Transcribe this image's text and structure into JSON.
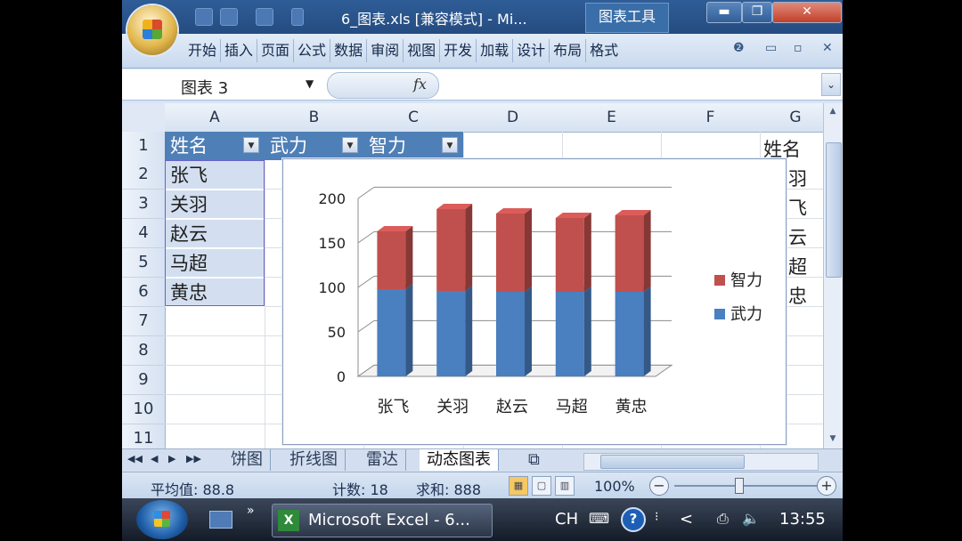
{
  "window": {
    "title": "6_图表.xls  [兼容模式] - Mi...",
    "context_tab": "图表工具",
    "buttons": {
      "minimize": "▬",
      "restore": "❐",
      "close": "✕"
    }
  },
  "ribbon": {
    "tabs": [
      "开始",
      "插入",
      "页面",
      "公式",
      "数据",
      "审阅",
      "视图",
      "开发",
      "加载",
      "设计",
      "布局",
      "格式"
    ],
    "help": "❷",
    "min": "▭",
    "restore": "▫",
    "close": "✕"
  },
  "formula_bar": {
    "name_box": "图表 3",
    "name_arrow": "▼",
    "fx": "fx",
    "expand": "⌄"
  },
  "columns": [
    "A",
    "B",
    "C",
    "D",
    "E",
    "F",
    "G"
  ],
  "rows": [
    "1",
    "2",
    "3",
    "4",
    "5",
    "6",
    "7",
    "8",
    "9",
    "10",
    "11"
  ],
  "table": {
    "headers": [
      "姓名",
      "武力",
      "智力"
    ],
    "names": [
      "张飞",
      "关羽",
      "赵云",
      "马超",
      "黄忠"
    ],
    "col_g": [
      "姓名",
      "羽",
      "飞",
      "云",
      "超",
      "忠"
    ],
    "filter_arrow": "▼"
  },
  "chart_data": {
    "type": "bar",
    "stacked": true,
    "style": "3d-column",
    "categories": [
      "张飞",
      "关羽",
      "赵云",
      "马超",
      "黄忠"
    ],
    "series": [
      {
        "name": "武力",
        "color": "#4a7fc0",
        "values": [
          98,
          96,
          95,
          95,
          95
        ]
      },
      {
        "name": "智力",
        "color": "#c0504d",
        "values": [
          65,
          92,
          88,
          83,
          86
        ]
      }
    ],
    "ylim": [
      0,
      200
    ],
    "yticks": [
      "0",
      "50",
      "100",
      "150",
      "200"
    ],
    "grid": true,
    "legend": "right"
  },
  "sheet_tabs": {
    "nav": [
      "◀◀",
      "◀",
      "▶",
      "▶▶"
    ],
    "tabs": [
      "饼图",
      "折线图",
      "雷达",
      "动态图表"
    ],
    "active": "动态图表"
  },
  "status": {
    "average": "平均值: 88.8",
    "count": "计数: 18",
    "sum": "求和: 888",
    "zoom": "100%",
    "zoom_minus": "−",
    "zoom_plus": "+"
  },
  "taskbar": {
    "app_label": "Microsoft Excel - 6...",
    "lang": "CH",
    "help": "?",
    "arrow": "<",
    "time": "13:55"
  }
}
